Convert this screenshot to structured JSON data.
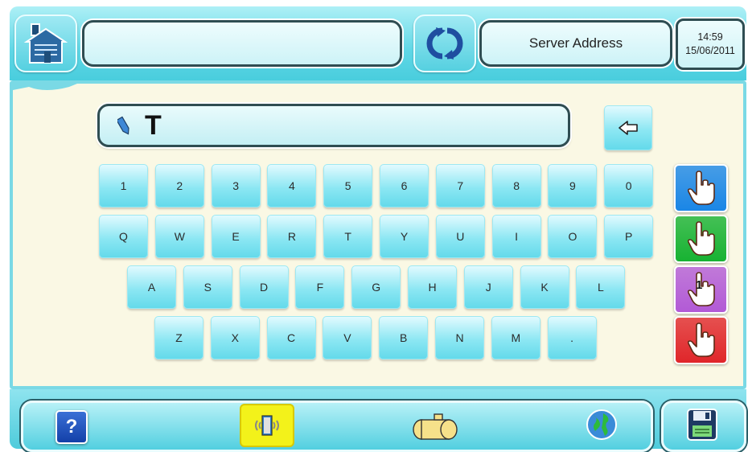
{
  "header": {
    "home_icon": "home-icon",
    "title_value": "",
    "refresh_icon": "refresh-icon",
    "server_label": "Server Address",
    "time": "14:59",
    "date": "15/06/2011"
  },
  "input": {
    "value": "T",
    "edit_icon": "pencil-icon",
    "backspace_icon": "backspace-icon"
  },
  "keyboard": {
    "row1": [
      "1",
      "2",
      "3",
      "4",
      "5",
      "6",
      "7",
      "8",
      "9",
      "0"
    ],
    "row2": [
      "Q",
      "W",
      "E",
      "R",
      "T",
      "Y",
      "U",
      "I",
      "O",
      "P"
    ],
    "row3": [
      "A",
      "S",
      "D",
      "F",
      "G",
      "H",
      "J",
      "K",
      "L"
    ],
    "row4": [
      "Z",
      "X",
      "C",
      "V",
      "B",
      "N",
      "M",
      "."
    ]
  },
  "side_buttons": [
    {
      "name": "hand-blue-button",
      "color": "#1a86e6",
      "label": ""
    },
    {
      "name": "hand-green-button",
      "color": "#17b232",
      "label": ""
    },
    {
      "name": "hand-purple-button",
      "color": "#b25ad6",
      "label": "1"
    },
    {
      "name": "hand-red-button",
      "color": "#e0262a",
      "label": ""
    }
  ],
  "footer": {
    "help_label": "?",
    "icons": [
      "help-icon",
      "door-icon",
      "tank-icon",
      "globe-icon",
      "save-icon"
    ]
  }
}
